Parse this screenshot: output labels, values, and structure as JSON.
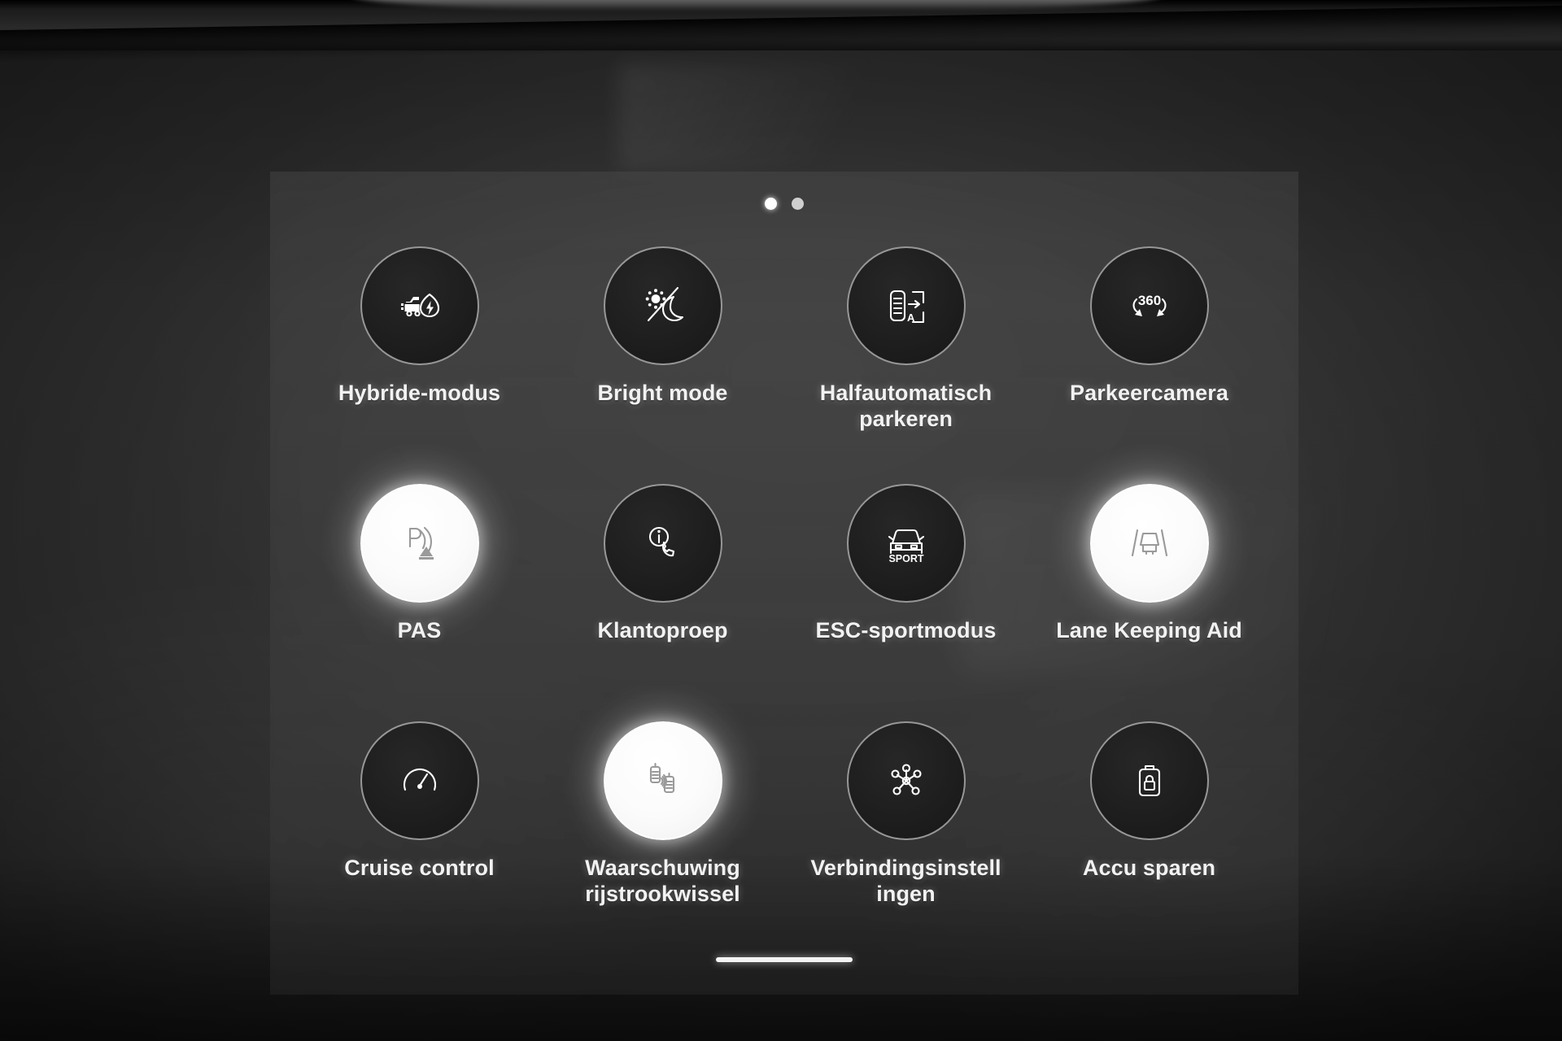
{
  "screen": {
    "pager": {
      "total": 2,
      "active_index": 0
    },
    "home_indicator": true
  },
  "theme": {
    "panel_bg": "#5a5a5a",
    "tile_off_bg": "#1d1d1d",
    "tile_on_bg": "#ffffff",
    "tile_border": "#bababa",
    "label_color": "#f2f2f2",
    "icon_on_color": "#9a9a9a",
    "icon_off_color": "#ffffff"
  },
  "quick_controls": {
    "rows": 3,
    "columns": 4,
    "items": [
      {
        "id": "hybride-modus",
        "label": "Hybride-modus",
        "icon": "hybrid-car-leaf-icon",
        "active": false
      },
      {
        "id": "bright-mode",
        "label": "Bright mode",
        "icon": "sun-moon-icon",
        "active": false
      },
      {
        "id": "halfautomatisch-parkeren",
        "label": "Halfautomatisch parkeren",
        "icon": "semi-auto-park-icon",
        "active": false
      },
      {
        "id": "parkeercamera",
        "label": "Parkeercamera",
        "icon": "camera-360-icon",
        "active": false
      },
      {
        "id": "pas",
        "label": "PAS",
        "icon": "park-assist-sensor-icon",
        "active": true
      },
      {
        "id": "klantoproep",
        "label": "Klantoproep",
        "icon": "info-phone-call-icon",
        "active": false
      },
      {
        "id": "esc-sportmodus",
        "label": "ESC-sportmodus",
        "icon": "car-sport-icon",
        "active": false
      },
      {
        "id": "lane-keeping-aid",
        "label": "Lane Keeping Aid",
        "icon": "lane-keeping-icon",
        "active": true
      },
      {
        "id": "cruise-control",
        "label": "Cruise control",
        "icon": "speedometer-icon",
        "active": false
      },
      {
        "id": "waarschuwing-rijstrookwissel",
        "label": "Waarschuwing rijstrookwissel",
        "icon": "lane-change-warning-icon",
        "active": true
      },
      {
        "id": "verbindingsinstellingen",
        "label": "Verbindingsinstellingen",
        "icon": "network-hub-icon",
        "active": false
      },
      {
        "id": "accu-sparen",
        "label": "Accu sparen",
        "icon": "battery-lock-icon",
        "active": false
      }
    ]
  }
}
